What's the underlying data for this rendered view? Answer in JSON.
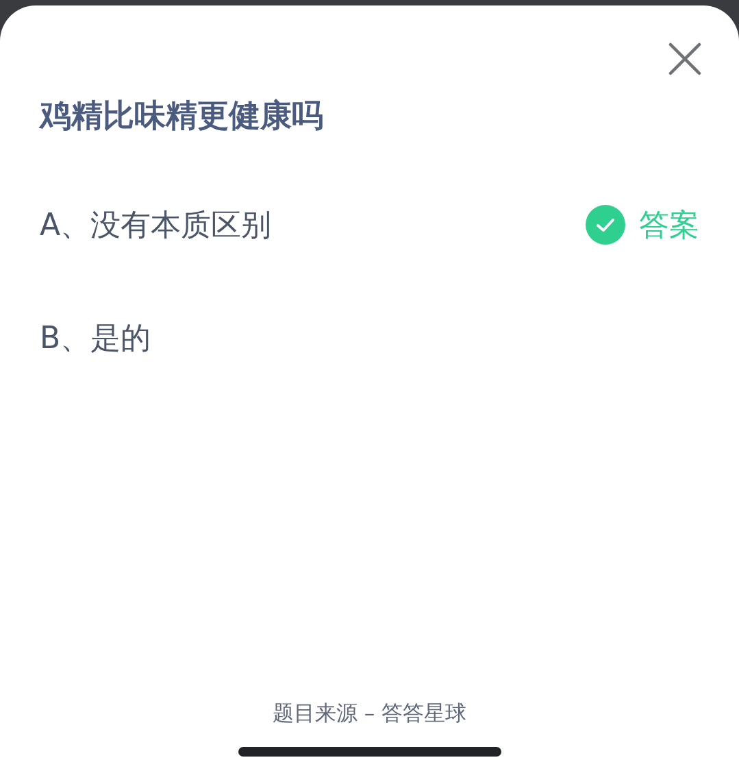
{
  "question": {
    "title": "鸡精比味精更健康吗"
  },
  "options": [
    {
      "label": "A、没有本质区别",
      "correct": true
    },
    {
      "label": "B、是的",
      "correct": false
    }
  ],
  "answer_label": "答案",
  "source": "题目来源 – 答答星球"
}
